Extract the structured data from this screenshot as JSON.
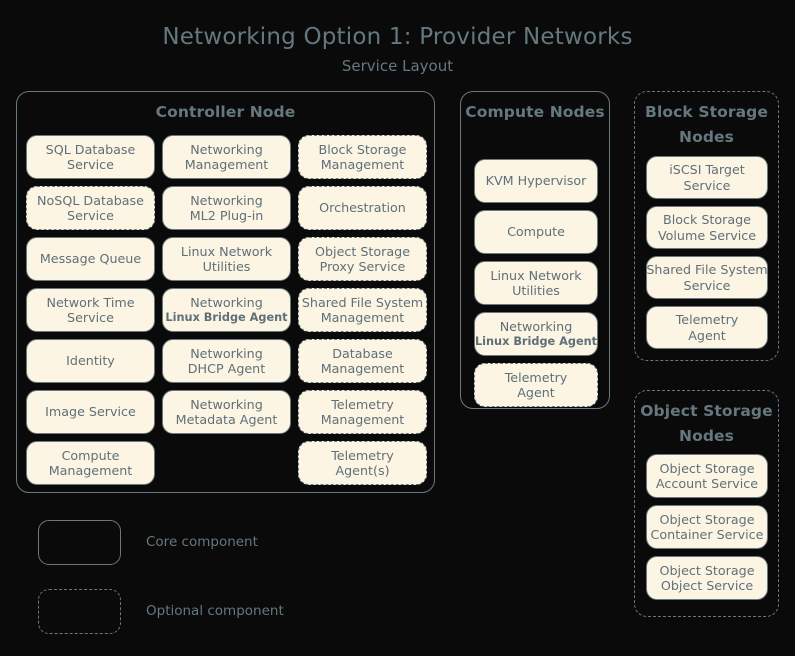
{
  "title": {
    "main": "Networking Option 1: Provider Networks",
    "sub": "Service Layout"
  },
  "colors": {
    "background": "#0a0a0a",
    "box_fill": "#fcf5e3",
    "text": "#5f7079",
    "title_text": "#65787f",
    "border": "#68797f"
  },
  "controller_node": {
    "title": "Controller Node",
    "style": "core",
    "columns": [
      {
        "items": [
          {
            "line1": "SQL Database",
            "line2": "Service",
            "style": "core"
          },
          {
            "line1": "NoSQL Database",
            "line2": "Service",
            "style": "optional"
          },
          {
            "line1": "Message Queue",
            "line2": "",
            "style": "core"
          },
          {
            "line1": "Network Time",
            "line2": "Service",
            "style": "core"
          },
          {
            "line1": "Identity",
            "line2": "",
            "style": "core"
          },
          {
            "line1": "Image Service",
            "line2": "",
            "style": "core"
          },
          {
            "line1": "Compute",
            "line2": "Management",
            "style": "core"
          }
        ]
      },
      {
        "items": [
          {
            "line1": "Networking",
            "line2": "Management",
            "style": "core"
          },
          {
            "line1": "Networking",
            "line2": "ML2 Plug-in",
            "style": "core"
          },
          {
            "line1": "Linux Network",
            "line2": "Utilities",
            "style": "core"
          },
          {
            "line1": "Networking",
            "line2": "Linux Bridge Agent",
            "line2_small": true,
            "style": "core"
          },
          {
            "line1": "Networking",
            "line2": "DHCP Agent",
            "style": "core"
          },
          {
            "line1": "Networking",
            "line2": "Metadata Agent",
            "style": "core"
          },
          {
            "line1": "",
            "line2": "",
            "style": "spacer"
          }
        ]
      },
      {
        "items": [
          {
            "line1": "Block Storage",
            "line2": "Management",
            "style": "optional"
          },
          {
            "line1": "Orchestration",
            "line2": "",
            "style": "optional"
          },
          {
            "line1": "Object Storage",
            "line2": "Proxy Service",
            "style": "optional"
          },
          {
            "line1": "Shared File System",
            "line2": "Management",
            "style": "optional"
          },
          {
            "line1": "Database",
            "line2": "Management",
            "style": "optional"
          },
          {
            "line1": "Telemetry",
            "line2": "Management",
            "style": "optional"
          },
          {
            "line1": "Telemetry",
            "line2": "Agent(s)",
            "style": "optional"
          }
        ]
      }
    ]
  },
  "compute_nodes": {
    "title_line1": "Compute",
    "title_line2": "Nodes",
    "style": "core",
    "items": [
      {
        "line1": "KVM Hypervisor",
        "line2": "",
        "style": "core"
      },
      {
        "line1": "Compute",
        "line2": "",
        "style": "core"
      },
      {
        "line1": "Linux Network",
        "line2": "Utilities",
        "style": "core"
      },
      {
        "line1": "Networking",
        "line2": "Linux Bridge Agent",
        "line2_small": true,
        "style": "core"
      },
      {
        "line1": "Telemetry",
        "line2": "Agent",
        "style": "optional"
      }
    ]
  },
  "block_storage_nodes": {
    "title_line1": "Block Storage",
    "title_line2": "Nodes",
    "style": "optional",
    "items": [
      {
        "line1": "iSCSI Target",
        "line2": "Service",
        "style": "core"
      },
      {
        "line1": "Block Storage",
        "line2": "Volume Service",
        "style": "core"
      },
      {
        "line1": "Shared File System",
        "line2": "Service",
        "style": "core"
      },
      {
        "line1": "Telemetry",
        "line2": "Agent",
        "style": "core"
      }
    ]
  },
  "object_storage_nodes": {
    "title_line1": "Object",
    "title_line2": "Storage Nodes",
    "style": "optional",
    "items": [
      {
        "line1": "Object Storage",
        "line2": "Account Service",
        "style": "core"
      },
      {
        "line1": "Object Storage",
        "line2": "Container Service",
        "style": "core"
      },
      {
        "line1": "Object Storage",
        "line2": "Object Service",
        "style": "core"
      }
    ]
  },
  "legend": [
    {
      "style": "core",
      "label": "Core component"
    },
    {
      "style": "optional",
      "label": "Optional component"
    }
  ]
}
